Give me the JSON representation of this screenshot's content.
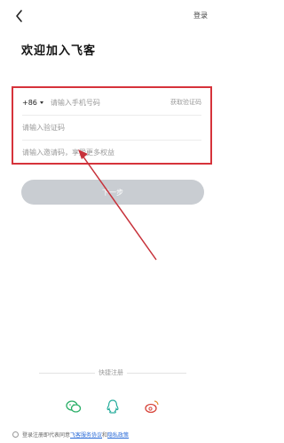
{
  "header": {
    "back_icon": "chevron-left-icon",
    "login_label": "登录"
  },
  "page_title": "欢迎加入飞客",
  "form": {
    "country_code": "+86",
    "phone_placeholder": "请输入手机号码",
    "get_code_label": "获取验证码",
    "code_placeholder": "请输入验证码",
    "invite_placeholder": "请输入邀请码，享受更多权益"
  },
  "next_button_label": "下一步",
  "quick_register_label": "快捷注册",
  "social": [
    {
      "name": "wechat-icon",
      "color": "#2aae67"
    },
    {
      "name": "qq-icon",
      "color": "#2aae9e"
    },
    {
      "name": "weibo-icon",
      "color": "#d7453b"
    }
  ],
  "agreement": {
    "prefix": "登录注册即代表同意",
    "service_link": "飞客服务协议",
    "and": "和",
    "privacy_link": "隐私政策"
  },
  "colors": {
    "highlight_box": "#d6333b",
    "button_disabled": "#c9cdd2",
    "link": "#2a6bd8"
  }
}
